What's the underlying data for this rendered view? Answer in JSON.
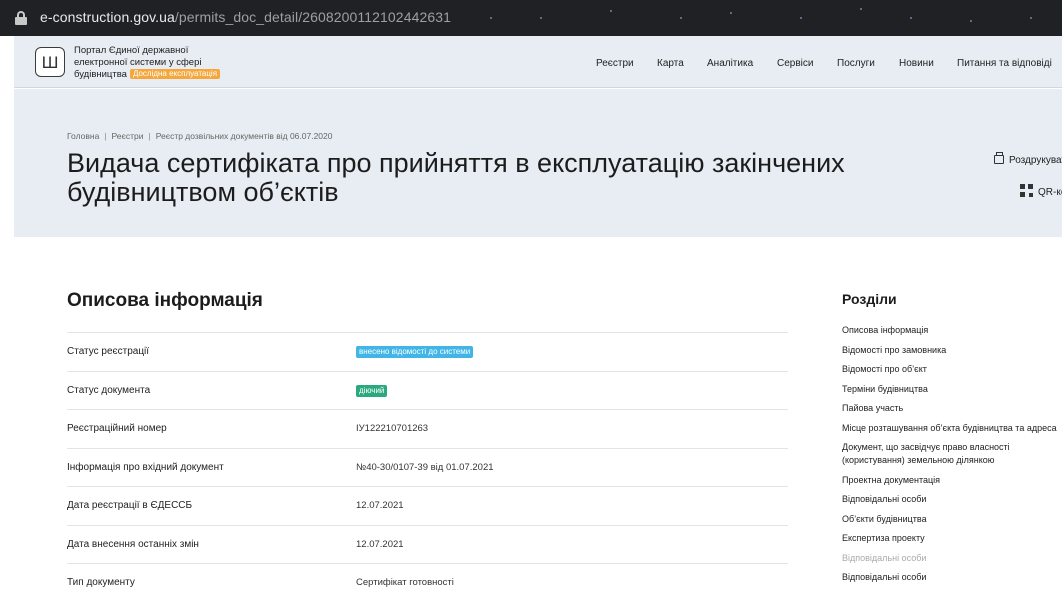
{
  "browser": {
    "url_domain": "e-construction.gov.ua",
    "url_path": "/permits_doc_detail/2608200112102442631"
  },
  "header": {
    "brand_line1": "Портал Єдиної державної",
    "brand_line2": "електронної системи у сфері",
    "brand_line3": "будівництва",
    "beta_badge": "Дослідна експлуатація",
    "nav": [
      "Реєстри",
      "Карта",
      "Аналітика",
      "Сервіси",
      "Послуги",
      "Новини",
      "Питання та відповіді"
    ]
  },
  "breadcrumb": [
    "Головна",
    "Реєстри",
    "Реєстр дозвільних документів від 06.07.2020"
  ],
  "page_title": "Видача сертифіката про прийняття в експлуатацію закінчених будівництвом об’єктів",
  "actions": {
    "print": "Роздрукувати",
    "qr": "QR-код"
  },
  "section": {
    "title": "Описова інформація",
    "rows": [
      {
        "label": "Статус реєстрації",
        "value": "внесено відомості до системи",
        "type": "pill",
        "color": "#41b6e6"
      },
      {
        "label": "Статус документа",
        "value": "діючий",
        "type": "pill",
        "color": "#2aa87e"
      },
      {
        "label": "Реєстраційний номер",
        "value": "ІУ122210701263",
        "type": "text"
      },
      {
        "label": "Інформація про вхідний документ",
        "value": "№40-30/0107-39 від 01.07.2021",
        "type": "text"
      },
      {
        "label": "Дата реєстрації в ЄДЕССБ",
        "value": "12.07.2021",
        "type": "text"
      },
      {
        "label": "Дата внесення останніх змін",
        "value": "12.07.2021",
        "type": "text"
      },
      {
        "label": "Тип документу",
        "value": "Сертифікат готовності",
        "type": "text"
      }
    ]
  },
  "sidebar": {
    "title": "Розділи",
    "items": [
      {
        "label": "Описова інформація"
      },
      {
        "label": "Відомості про замовника"
      },
      {
        "label": "Відомості про об’єкт"
      },
      {
        "label": "Терміни будівництва"
      },
      {
        "label": "Пайова участь"
      },
      {
        "label": "Місце розташування об’єкта будівництва та адреса"
      },
      {
        "label": "Документ, що засвідчує право власності (користування) земельною ділянкою",
        "wrap": true
      },
      {
        "label": "Проектна документація"
      },
      {
        "label": "Відповідальні особи"
      },
      {
        "label": "Об’єкти будівництва"
      },
      {
        "label": "Експертиза проекту"
      },
      {
        "label": "Відповідальні особи",
        "muted": true
      },
      {
        "label": "Відповідальні особи"
      }
    ]
  }
}
